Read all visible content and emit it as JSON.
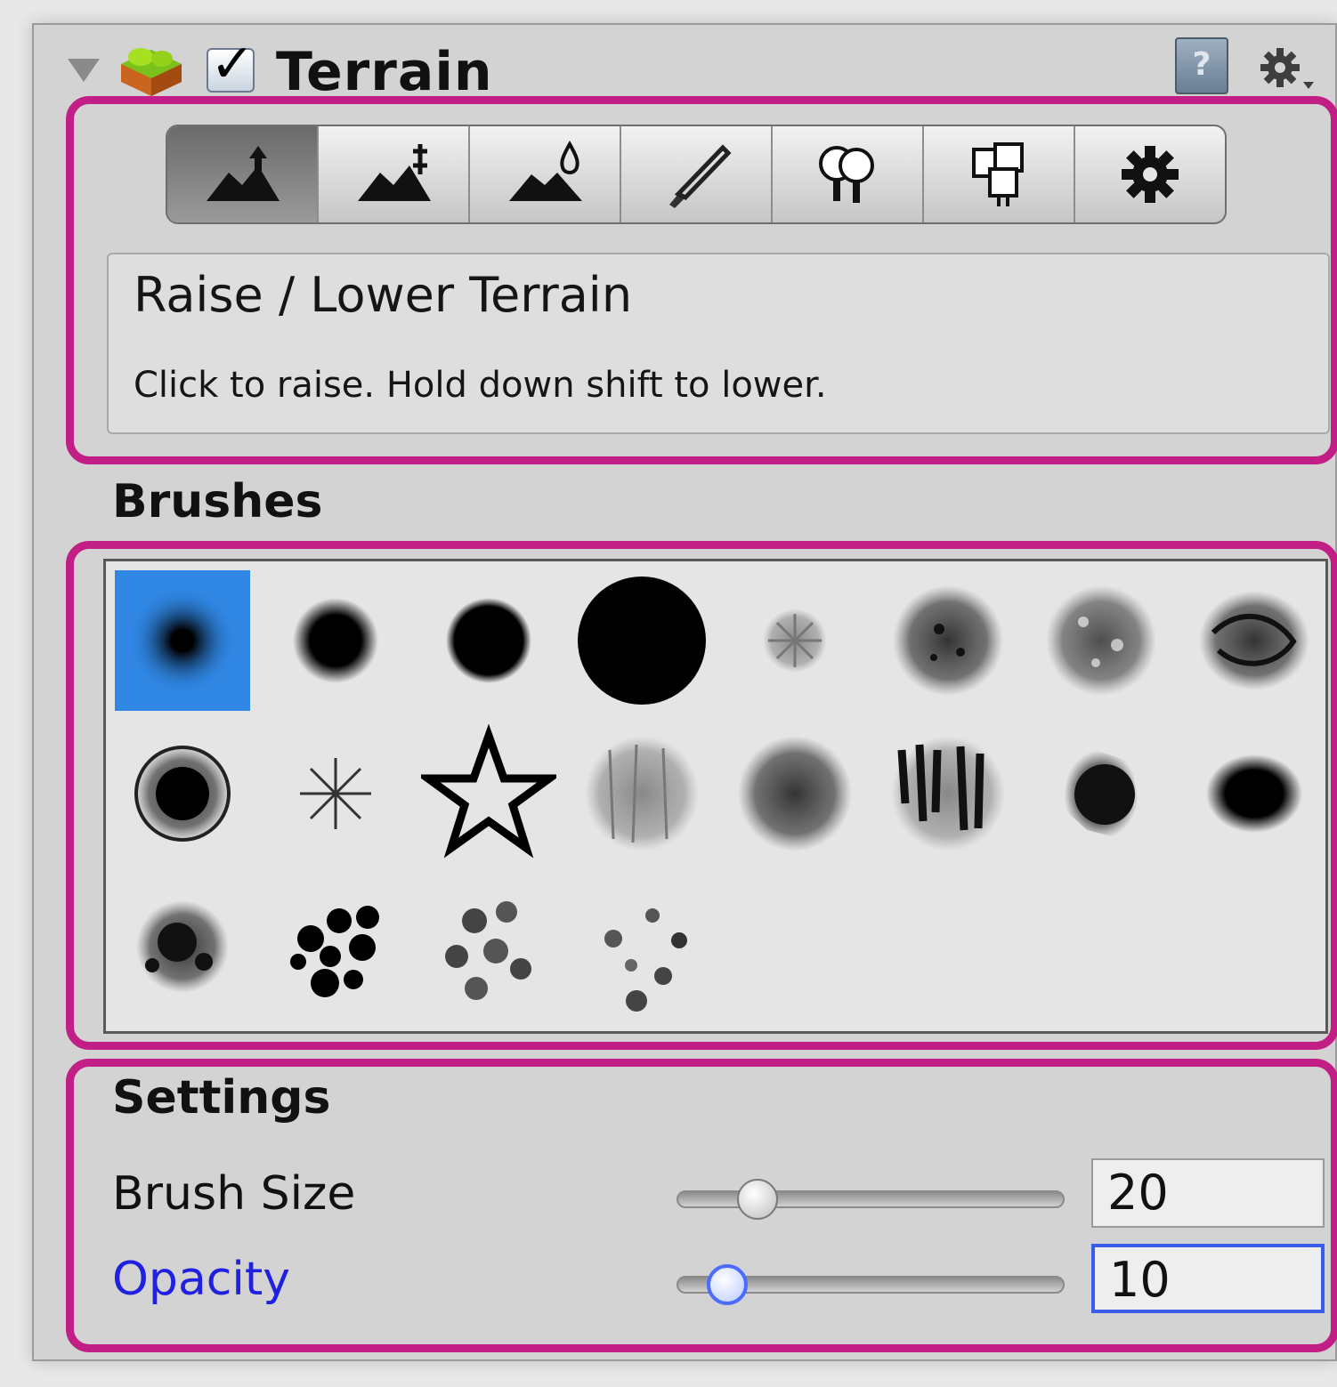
{
  "component": {
    "title": "Terrain",
    "enabled": true
  },
  "toolbar": {
    "tools": [
      {
        "icon": "raise-lower-terrain-icon",
        "active": true
      },
      {
        "icon": "paint-height-icon",
        "active": false
      },
      {
        "icon": "smooth-height-icon",
        "active": false
      },
      {
        "icon": "paint-texture-icon",
        "active": false
      },
      {
        "icon": "place-trees-icon",
        "active": false
      },
      {
        "icon": "paint-details-icon",
        "active": false
      },
      {
        "icon": "terrain-settings-icon",
        "active": false
      }
    ]
  },
  "description": {
    "title": "Raise / Lower Terrain",
    "text": "Click to raise. Hold down shift to lower."
  },
  "brushes": {
    "heading": "Brushes",
    "selected_index": 0,
    "count": 20
  },
  "settings": {
    "heading": "Settings",
    "brush_size": {
      "label": "Brush Size",
      "value": "20",
      "slider_fraction": 0.2
    },
    "opacity": {
      "label": "Opacity",
      "value": "10",
      "slider_fraction": 0.12
    }
  },
  "colors": {
    "highlight": "#c21f86",
    "selection": "#2f86e3",
    "focus": "#3a5ce8"
  }
}
